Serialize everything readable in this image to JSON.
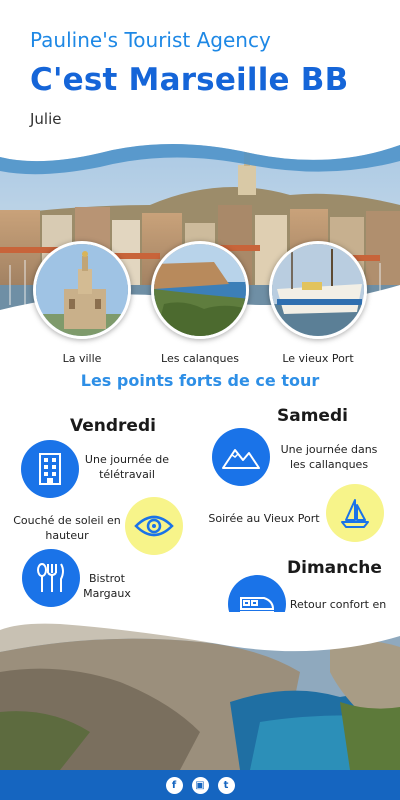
{
  "header": {
    "agency": "Pauline's Tourist Agency",
    "title": "C'est Marseille BB",
    "author": "Julie"
  },
  "highlights": [
    {
      "label": "La ville"
    },
    {
      "label": "Les calanques"
    },
    {
      "label": "Le vieux Port"
    }
  ],
  "section_title": "Les points forts de ce tour",
  "days": {
    "friday": {
      "name": "Vendredi",
      "activities": [
        {
          "text": "Une journée de télétravail",
          "icon": "building-icon"
        },
        {
          "text": "Couché de soleil en hauteur",
          "icon": "eye-icon"
        },
        {
          "text": "Bistrot Margaux",
          "icon": "cutlery-icon"
        }
      ]
    },
    "saturday": {
      "name": "Samedi",
      "activities": [
        {
          "text": "Une journée dans les callanques",
          "icon": "mountain-icon"
        },
        {
          "text": "Soirée au Vieux Port",
          "icon": "sailboat-icon"
        }
      ]
    },
    "sunday": {
      "name": "Dimanche",
      "activities": [
        {
          "text": "Retour confort en train",
          "icon": "train-icon"
        }
      ]
    }
  },
  "footer": {
    "social": [
      "f",
      "▣",
      "t"
    ]
  },
  "colors": {
    "accent": "#1a73e8",
    "title": "#1565d8",
    "yellow": "#f7f48a",
    "footer": "#1565c0"
  }
}
